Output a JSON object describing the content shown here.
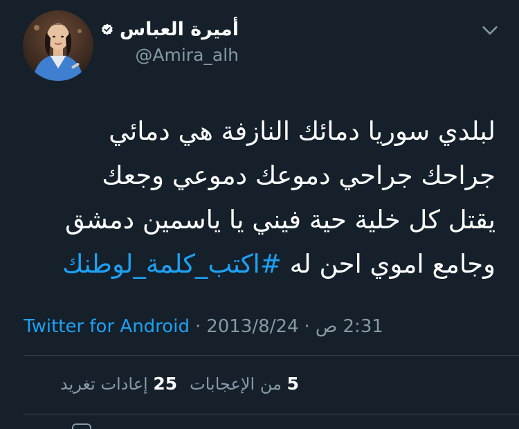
{
  "user": {
    "display_name": "أميرة العباس",
    "handle": "@Amira_alh",
    "verified": true
  },
  "tweet": {
    "lines": [
      "لبلدي سوريا دمائك النازفة هي دمائي",
      "جراحك جراحي دموعك دموعي وجعك",
      "يقتل كل خلية حية فيني يا ياسمين دمشق"
    ],
    "last_line_text": "وجامع اموي احن له ",
    "hashtag": "#اكتب_كلمة_لوطنك"
  },
  "meta": {
    "source": "Twitter for Android",
    "separator": "·",
    "date": "2013/8/24",
    "time": "2:31 ص"
  },
  "stats": {
    "retweets_count": "25",
    "retweets_label": "إعادات تغريد",
    "likes_count": "5",
    "likes_label": "من الإعجابات"
  },
  "colors": {
    "background": "#15202b",
    "accent": "#1da1f2",
    "muted": "#8899a6",
    "divider": "#38444d"
  },
  "icons": {
    "verified": "verified-badge-icon",
    "menu": "chevron-down-icon"
  }
}
